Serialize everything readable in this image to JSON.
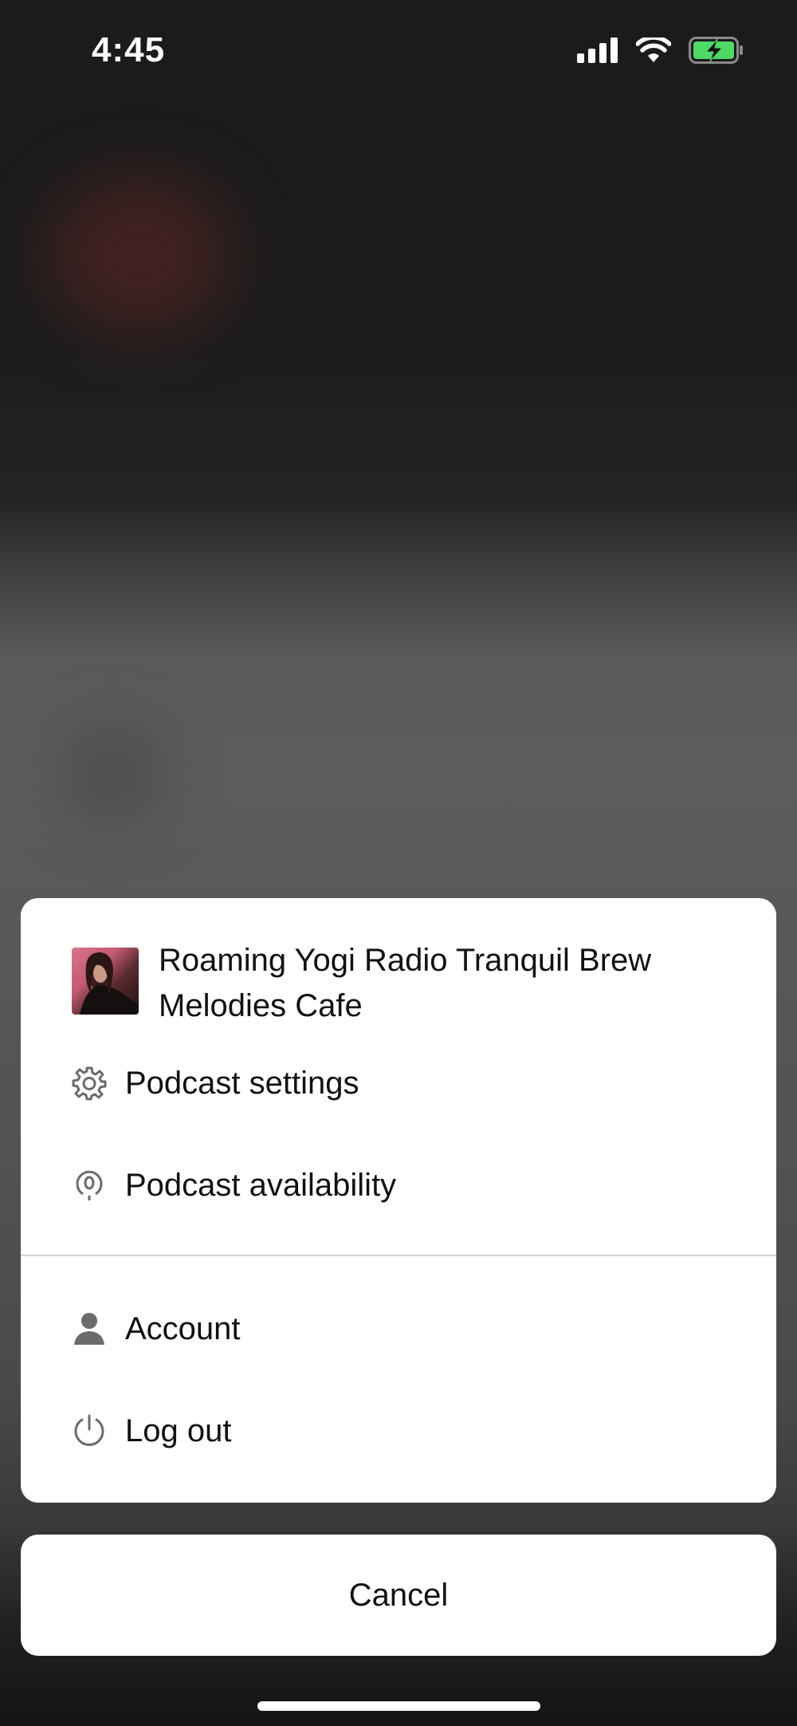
{
  "status_bar": {
    "time": "4:45",
    "icons": [
      "cellular-signal-icon",
      "wifi-icon",
      "battery-charging-icon"
    ],
    "battery_color": "#4cd964"
  },
  "sheet": {
    "podcast": {
      "title": "Roaming Yogi Radio Tranquil Brew Melodies Cafe",
      "cover_icon": "podcast-cover-image"
    },
    "menu_items": [
      {
        "label": "Podcast settings",
        "icon": "gear-icon"
      },
      {
        "label": "Podcast availability",
        "icon": "podcast-location-icon"
      },
      {
        "label": "Account",
        "icon": "person-icon"
      },
      {
        "label": "Log out",
        "icon": "power-icon"
      }
    ]
  },
  "cancel": {
    "label": "Cancel"
  },
  "colors": {
    "sheet_background": "#ffffff",
    "text": "#111111",
    "icon": "#6b6b6b",
    "divider": "#d4d4d4"
  }
}
